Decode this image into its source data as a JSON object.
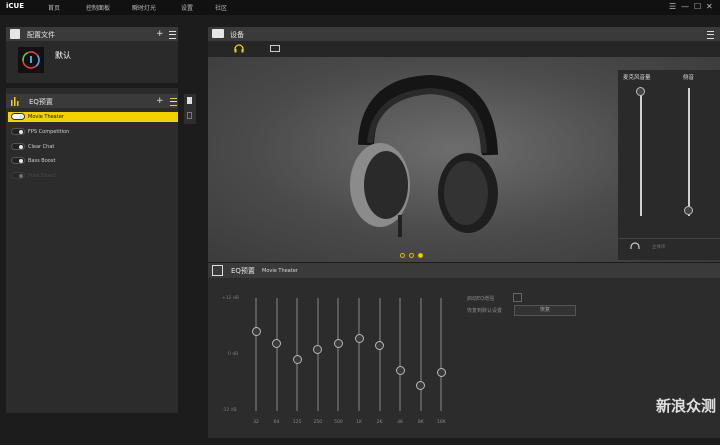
{
  "app": {
    "brand": "iCUE"
  },
  "nav": [
    "首页",
    "控制面板",
    "瞬时灯光",
    "设置",
    "社区"
  ],
  "window_controls": [
    "☰",
    "—",
    "☐",
    "✕"
  ],
  "profiles": {
    "title": "配置文件",
    "items": [
      {
        "name": "默认"
      }
    ]
  },
  "eq_presets": {
    "title": "EQ预置",
    "items": [
      {
        "label": "Movie Theater",
        "selected": true
      },
      {
        "label": "FPS Competition",
        "selected": false
      },
      {
        "label": "Clear Chat",
        "selected": false
      },
      {
        "label": "Bass Boost",
        "selected": false
      },
      {
        "label": "Pure Direct",
        "selected": false,
        "disabled": true
      }
    ]
  },
  "devices": {
    "title": "设备"
  },
  "mixer": {
    "mic_volume_label": "麦克风音量",
    "sidetone_label": "侧音",
    "mic_level": 0.97,
    "sidetone_level": 0.04,
    "footer_label": "立体声"
  },
  "eq_editor": {
    "title": "EQ预置",
    "preset_name": "Movie Theater",
    "db_labels": [
      "+12 dB",
      "0 dB",
      "-12 dB"
    ],
    "bands": [
      {
        "freq": "32",
        "level": 0.7
      },
      {
        "freq": "64",
        "level": 0.6
      },
      {
        "freq": "125",
        "level": 0.46
      },
      {
        "freq": "250",
        "level": 0.54
      },
      {
        "freq": "500",
        "level": 0.6
      },
      {
        "freq": "1K",
        "level": 0.64
      },
      {
        "freq": "2K",
        "level": 0.58
      },
      {
        "freq": "4K",
        "level": 0.36
      },
      {
        "freq": "8K",
        "level": 0.23
      },
      {
        "freq": "16K",
        "level": 0.34
      }
    ],
    "smart_eq_label": "启动EQ增强",
    "reset_label": "恢复到默认设置",
    "reset_button": "恢复"
  },
  "carousel": {
    "count": 3,
    "active": 2
  },
  "watermark": "新浪众测",
  "colors": {
    "accent": "#f2d100",
    "panel": "#2f2f2f",
    "background": "#1c1c1c"
  }
}
